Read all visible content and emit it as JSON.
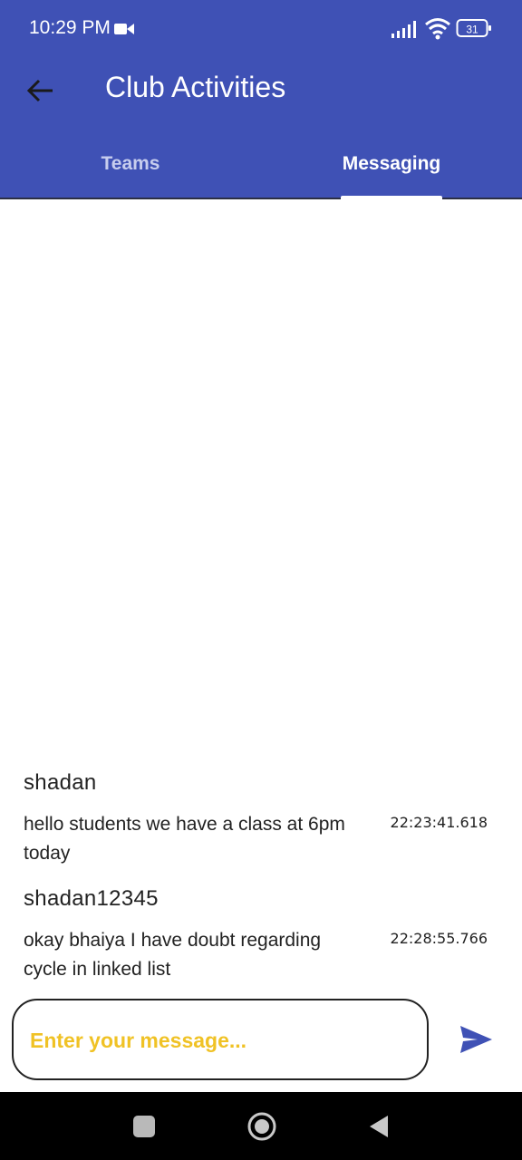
{
  "status_bar": {
    "time": "10:29 PM",
    "battery": "31"
  },
  "toolbar": {
    "title": "Club Activities"
  },
  "tabs": [
    {
      "label": "Teams"
    },
    {
      "label": "Messaging"
    }
  ],
  "messages": [
    {
      "user": "shadan",
      "text": "hello students we have a class at 6pm today",
      "time": "22:23:41.618"
    },
    {
      "user": "shadan12345",
      "text": "okay bhaiya I have doubt regarding cycle in linked list",
      "time": "22:28:55.766"
    }
  ],
  "input": {
    "placeholder": "Enter your message..."
  },
  "colors": {
    "app_bar": "#3f51b5",
    "placeholder": "#f0c225",
    "send_icon": "#3f51b5"
  }
}
